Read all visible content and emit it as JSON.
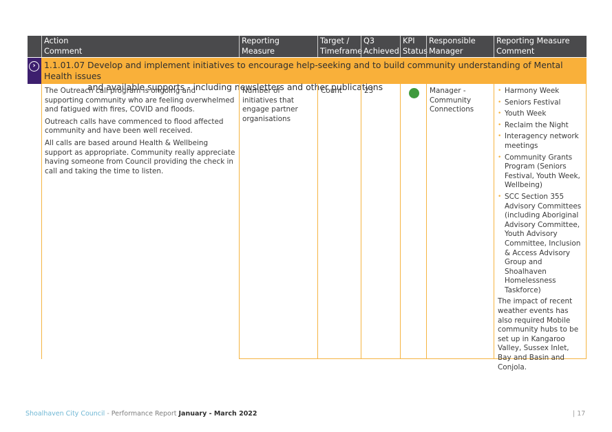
{
  "table": {
    "headers": [
      {
        "line1": "Action",
        "line2": "Comment"
      },
      {
        "line1": "Reporting",
        "line2": "Measure"
      },
      {
        "line1": "Target /",
        "line2": "Timeframe"
      },
      {
        "line1": "Q3",
        "line2": "Achieved"
      },
      {
        "line1": "KPI",
        "line2": "Status"
      },
      {
        "line1": "Responsible",
        "line2": "Manager"
      },
      {
        "line1": "Reporting Measure",
        "line2": "Comment"
      }
    ],
    "action_band": {
      "icon": "chevron-right-circle-icon",
      "line1": "1.1.01.07 Develop and implement initiatives to encourage help-seeking and to build  community understanding of Mental Health issues",
      "line2": "and available supports - including newsletters and other publications"
    },
    "row": {
      "comment_paragraphs": [
        "The Outreach call program is ongoing and supporting community who are feeling overwhelmed and fatigued with fires, COVID and floods.",
        "Outreach calls have commenced to flood affected community and have been well received.",
        "All calls are based around Health & Wellbeing support as appropriate. Community really appreciate having someone from Council providing the check in call and taking the time to listen."
      ],
      "reporting_measure": "Number of initiatives that engage partner organisations",
      "target_timeframe": "Count",
      "q3_achieved": "23",
      "kpi_status": "on-track",
      "kpi_status_color": "#3f9a3e",
      "responsible_manager": "Manager - Community Connections",
      "measure_comment_bullets": [
        "Harmony Week",
        "Seniors Festival",
        "Youth Week",
        "Reclaim the Night",
        "Interagency network meetings",
        "Community Grants Program (Seniors Festival, Youth Week, Wellbeing)",
        "SCC Section 355 Advisory Committees (including Aboriginal Advisory Committee, Youth Advisory Committee, Inclusion & Access Advisory Group and Shoalhaven Homelessness Taskforce)"
      ],
      "measure_comment_tail": "The impact of recent weather events has also required Mobile community hubs to be set up in Kangaroo Valley, Sussex Inlet, Bay and Basin and Conjola."
    }
  },
  "footer": {
    "organisation": "Shoalhaven City Council",
    "separator": " - ",
    "report": "Performance Report ",
    "period": "January - March 2022",
    "page_number": "| 17"
  },
  "colors": {
    "header_bg": "#4a4a4c",
    "band_bg": "#f9b03a",
    "icon_bg": "#3d1f6e",
    "border": "#f5b441",
    "org_text": "#6fb7d4"
  }
}
